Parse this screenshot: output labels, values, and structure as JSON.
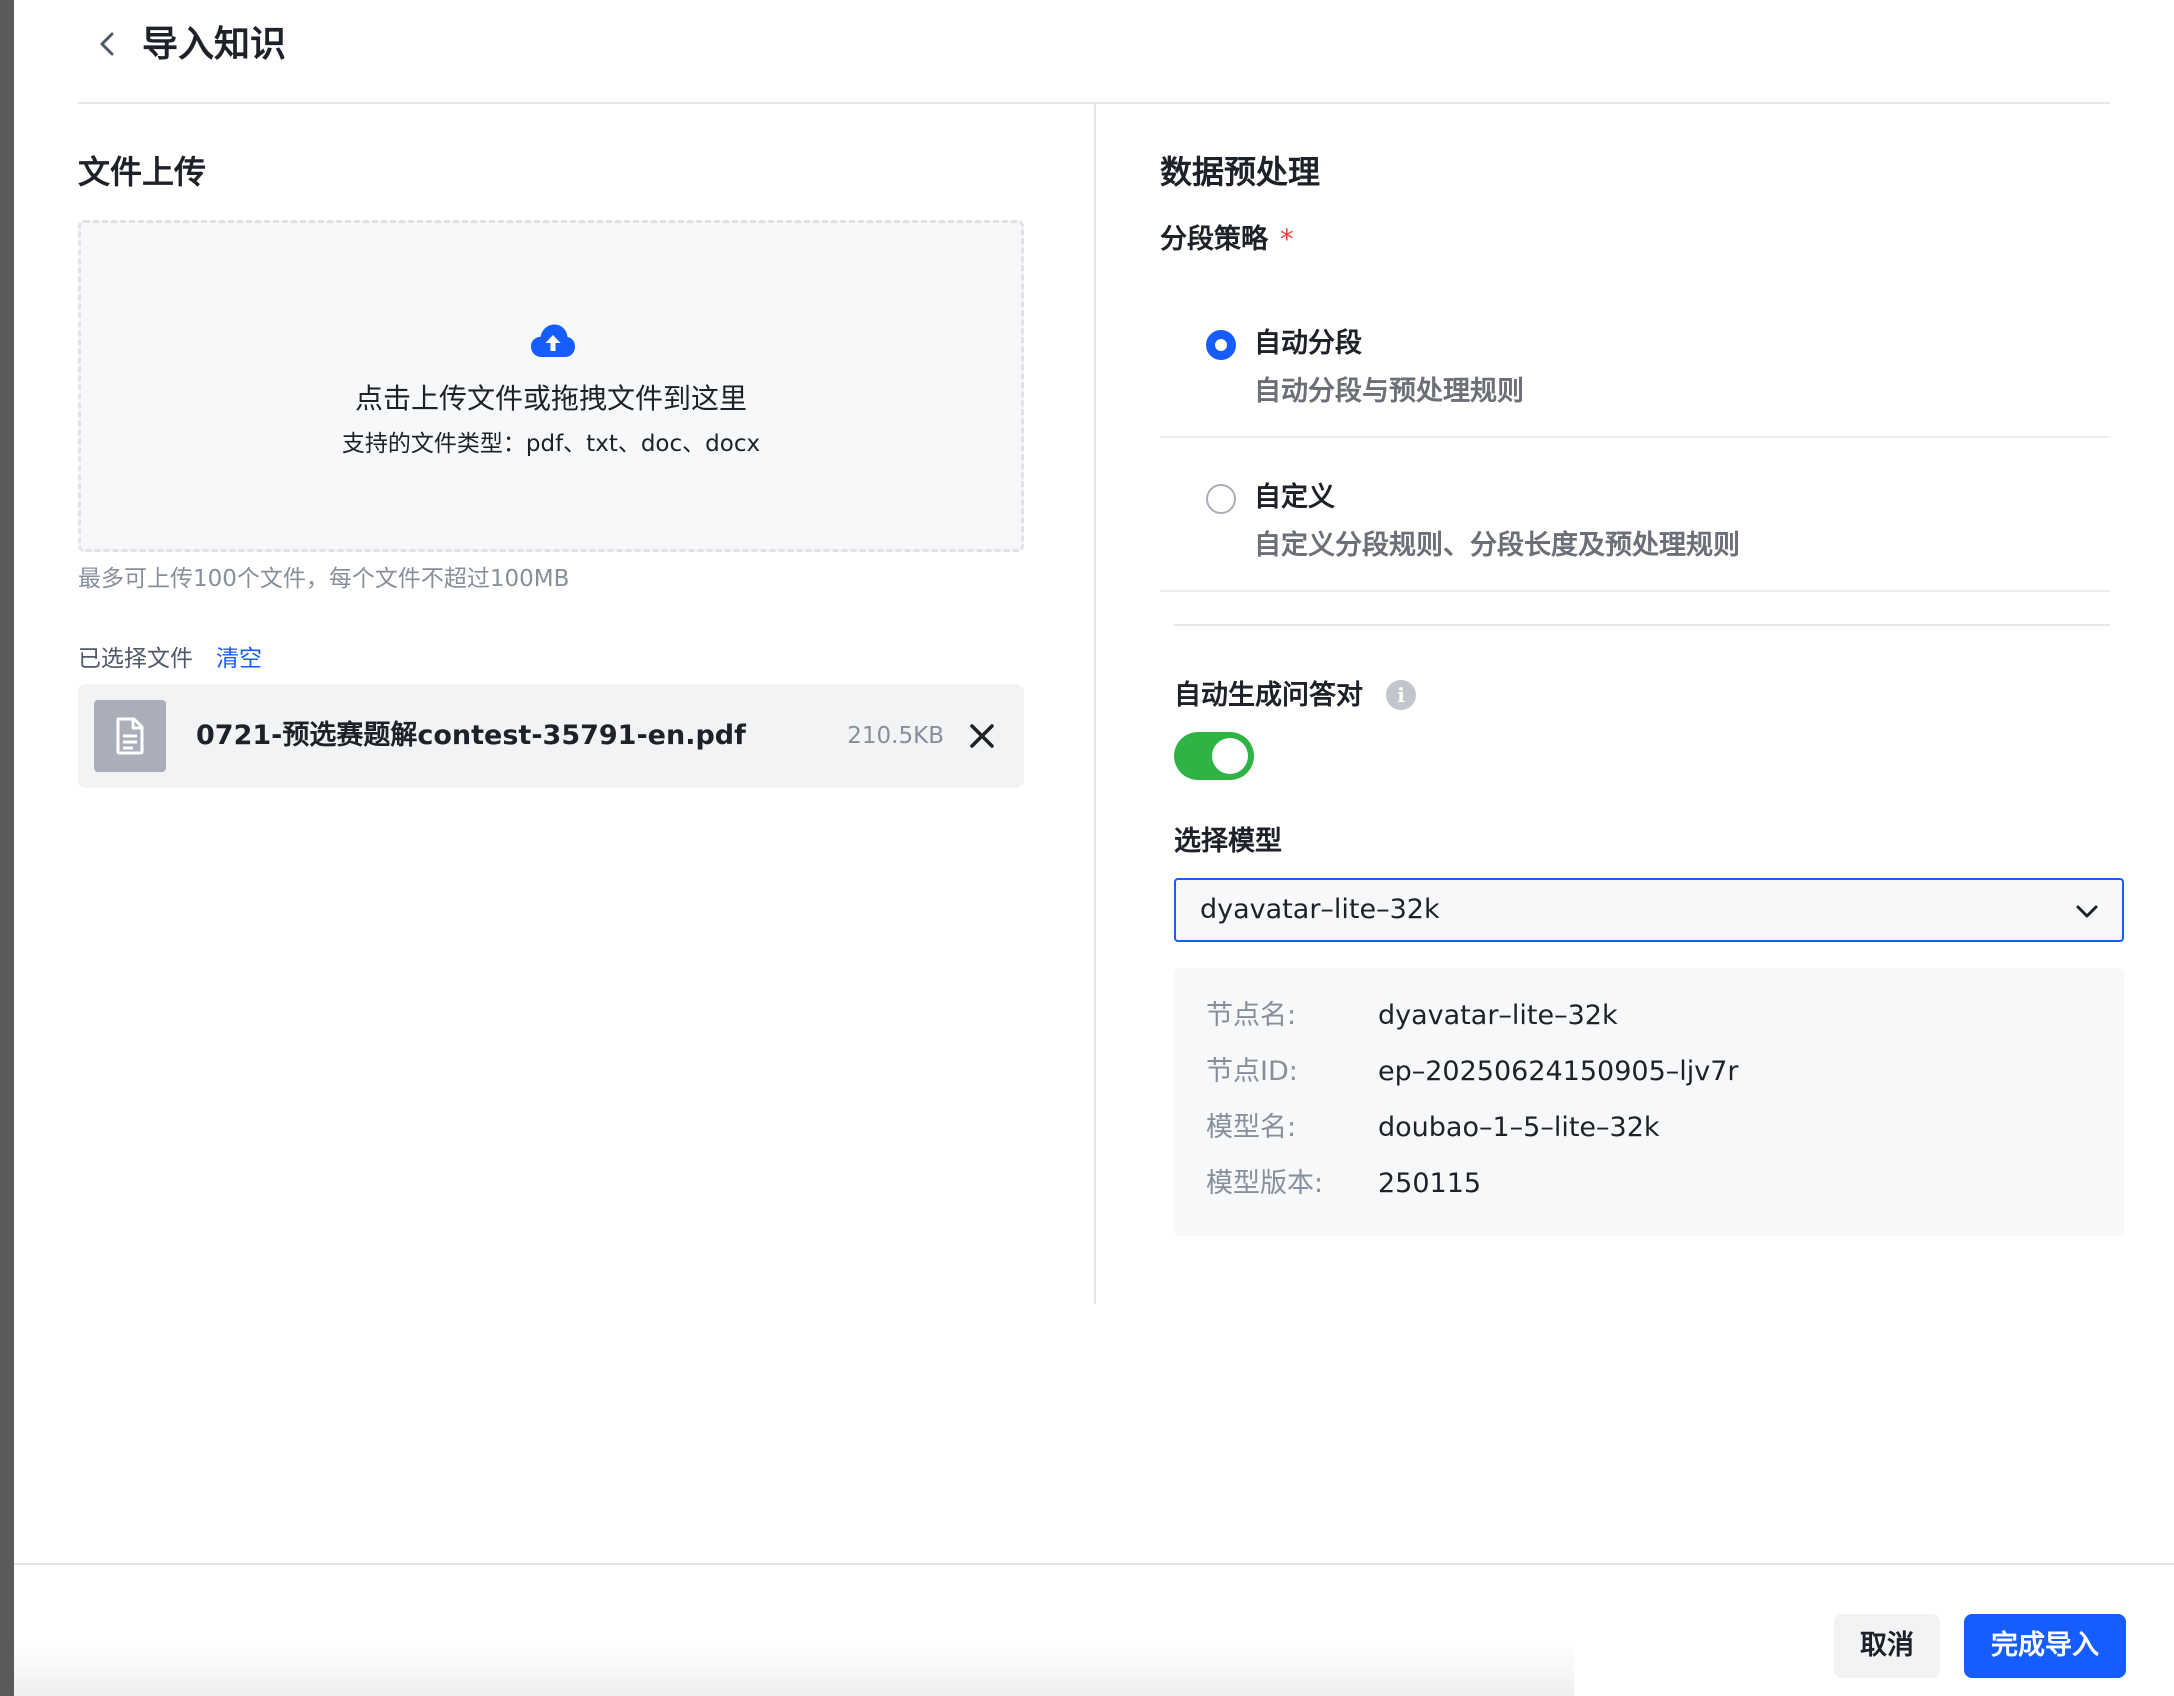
{
  "header": {
    "title": "导入知识"
  },
  "upload": {
    "section_title": "文件上传",
    "main_text": "点击上传文件或拖拽文件到这里",
    "sub_text": "支持的文件类型：pdf、txt、doc、docx",
    "hint": "最多可上传100个文件，每个文件不超过100MB",
    "selected_label": "已选择文件",
    "clear_label": "清空",
    "files": [
      {
        "name": "0721-预选赛题解contest-35791-en.pdf",
        "size": "210.5KB"
      }
    ]
  },
  "preprocess": {
    "section_title": "数据预处理",
    "strategy_label": "分段策略",
    "required_mark": "*",
    "options": [
      {
        "title": "自动分段",
        "desc": "自动分段与预处理规则",
        "checked": true
      },
      {
        "title": "自定义",
        "desc": "自定义分段规则、分段长度及预处理规则",
        "checked": false
      }
    ],
    "qa_label": "自动生成问答对",
    "qa_info_glyph": "i",
    "qa_enabled": true,
    "model_label": "选择模型",
    "model_selected": "dyavatar–lite–32k",
    "model_info": [
      {
        "key": "节点名:",
        "value": "dyavatar–lite–32k"
      },
      {
        "key": "节点ID:",
        "value": "ep–20250624150905–ljv7r"
      },
      {
        "key": "模型名:",
        "value": "doubao–1–5–lite–32k"
      },
      {
        "key": "模型版本:",
        "value": "250115"
      }
    ]
  },
  "footer": {
    "cancel_label": "取消",
    "confirm_label": "完成导入"
  },
  "colors": {
    "primary": "#165dff",
    "toggle_on": "#2fb344",
    "required": "#f53f3f"
  }
}
